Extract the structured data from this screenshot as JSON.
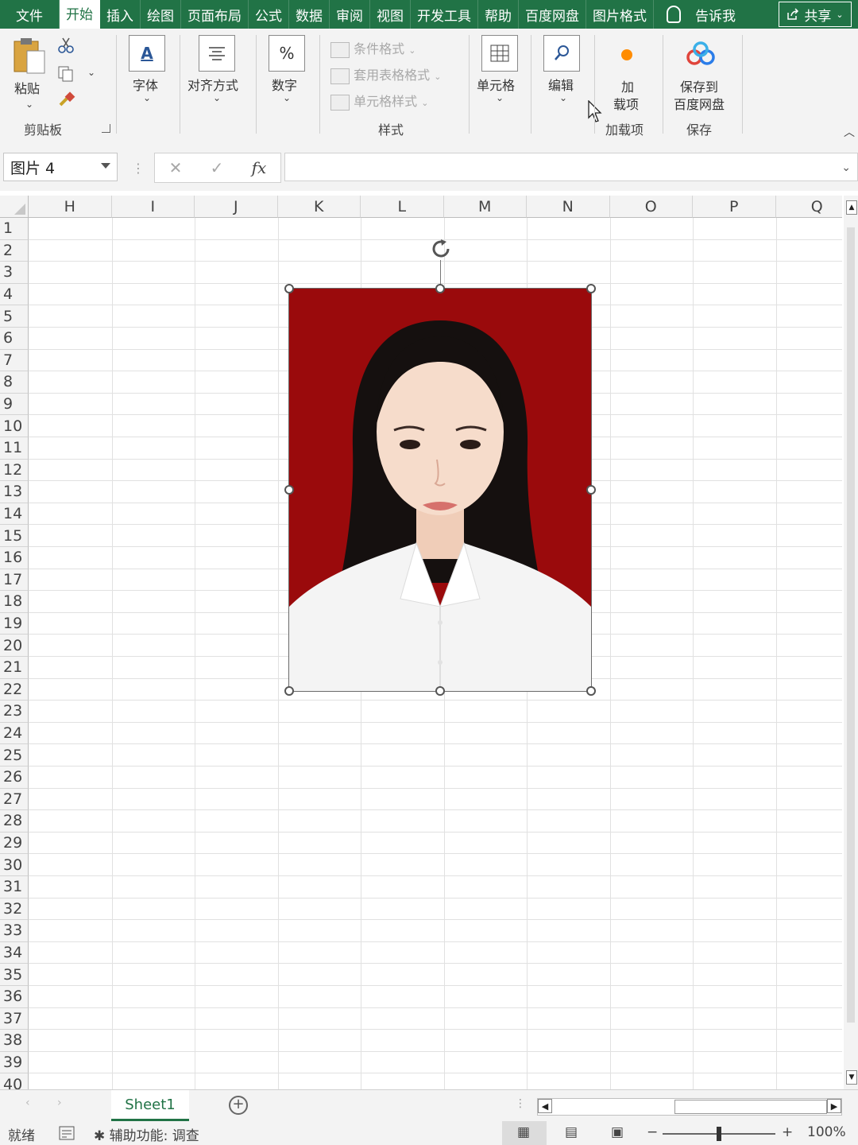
{
  "tabs": [
    "文件",
    "开始",
    "插入",
    "绘图",
    "页面布局",
    "公式",
    "数据",
    "审阅",
    "视图",
    "开发工具",
    "帮助",
    "百度网盘",
    "图片格式"
  ],
  "active_tab": "开始",
  "tell_me": "告诉我",
  "share_label": "共享",
  "ribbon": {
    "paste": "粘贴",
    "clipboard_group": "剪贴板",
    "font": "字体",
    "alignment": "对齐方式",
    "number": "数字",
    "conditional_format": "条件格式",
    "table_format": "套用表格格式",
    "cell_style": "单元格样式",
    "styles_group": "样式",
    "cells": "单元格",
    "editing": "编辑",
    "addin_line1": "加",
    "addin_line2": "载项",
    "addins_group": "加载项",
    "save_to_line1": "保存到",
    "save_to_line2": "百度网盘",
    "save_group": "保存"
  },
  "name_box": "图片 4",
  "formula_input": "",
  "columns": [
    "H",
    "I",
    "J",
    "K",
    "L",
    "M",
    "N",
    "O",
    "P",
    "Q"
  ],
  "rows": [
    "1",
    "2",
    "3",
    "4",
    "5",
    "6",
    "7",
    "8",
    "9",
    "10",
    "11",
    "12",
    "13",
    "14",
    "15",
    "16",
    "17",
    "18",
    "19",
    "20",
    "21",
    "22",
    "23",
    "24",
    "25",
    "26",
    "27",
    "28",
    "29",
    "30",
    "31",
    "32",
    "33",
    "34",
    "35",
    "36",
    "37",
    "38",
    "39",
    "40"
  ],
  "sheet_name": "Sheet1",
  "status": {
    "ready": "就绪",
    "accessibility": "辅助功能: 调查",
    "zoom": "100%"
  },
  "colors": {
    "excel_green": "#217346",
    "photo_background": "#9a0a0c"
  }
}
